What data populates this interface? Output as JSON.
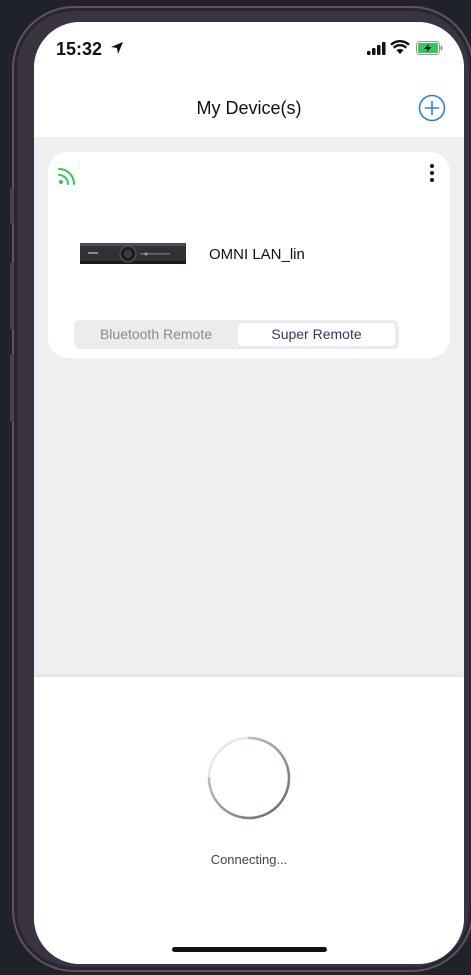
{
  "status_bar": {
    "time": "15:32",
    "icons": [
      "location-arrow-icon",
      "signal-icon",
      "wifi-icon",
      "battery-charging-icon"
    ]
  },
  "header": {
    "title": "My Device(s)",
    "add_icon": "plus-circle-icon"
  },
  "device_card": {
    "connection_icon": "wifi-signal-icon",
    "menu_icon": "more-vertical-icon",
    "device_name": "OMNI LAN_lin",
    "tabs": [
      {
        "label": "Bluetooth Remote",
        "selected": false
      },
      {
        "label": "Super Remote",
        "selected": true
      }
    ]
  },
  "overlay": {
    "status_text": "Connecting..."
  },
  "colors": {
    "accent_blue": "#2f7fe3",
    "connected_green": "#34c759",
    "selected_tab_text": "#2d3a63",
    "background": "#efeff1"
  }
}
